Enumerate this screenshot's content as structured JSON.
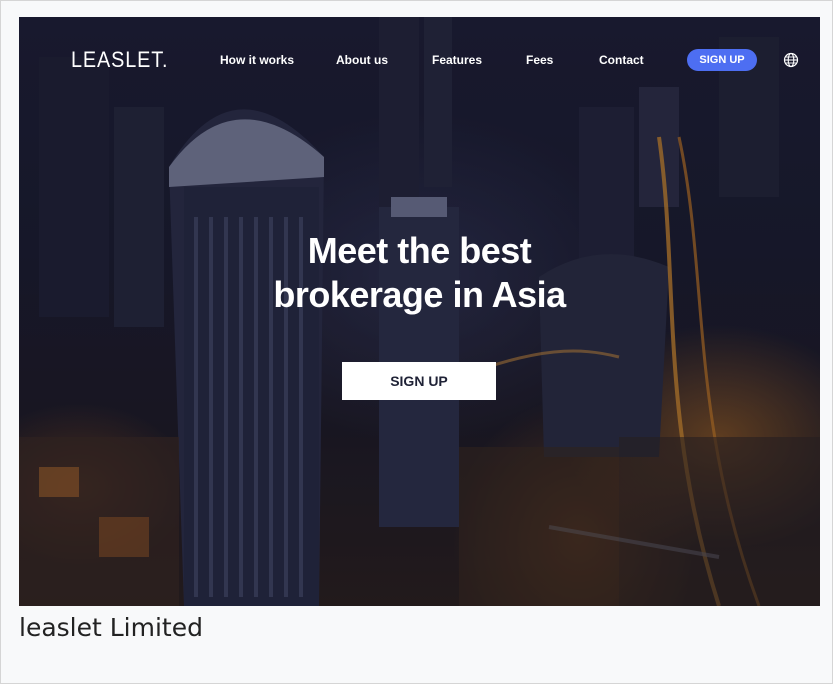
{
  "brand": {
    "logo_text": "LEASLET."
  },
  "nav": {
    "items": [
      {
        "label": "How it works"
      },
      {
        "label": "About us"
      },
      {
        "label": "Features"
      },
      {
        "label": "Fees"
      },
      {
        "label": "Contact"
      }
    ],
    "signup_label": "SIGN UP",
    "language_icon": "globe-icon"
  },
  "hero": {
    "headline_line1": "Meet the best",
    "headline_line2": "brokerage in Asia",
    "cta_label": "SIGN UP",
    "background": "night aerial city skyline photo"
  },
  "caption": {
    "text": "leaslet Limited"
  },
  "colors": {
    "accent": "#4d6ef2",
    "cta_bg": "#ffffff",
    "cta_text": "#1f2236",
    "page_bg": "#f8f9fa"
  }
}
